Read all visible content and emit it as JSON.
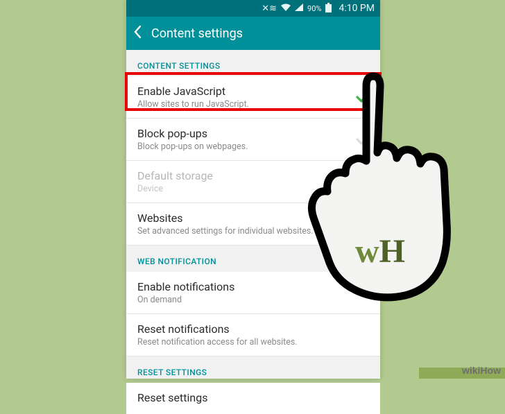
{
  "status": {
    "vibrate_icon": "📳",
    "wifi_icon": "📶",
    "signal_icon": "▲",
    "battery_percent": "90%",
    "battery_icon": "▮",
    "time": "4:10 PM"
  },
  "header": {
    "back_icon": "‹",
    "title": "Content settings"
  },
  "sections": {
    "content": {
      "label": "CONTENT SETTINGS",
      "items": [
        {
          "title": "Enable JavaScript",
          "sub": "Allow sites to run JavaScript.",
          "checked": true
        },
        {
          "title": "Block pop-ups",
          "sub": "Block pop-ups on webpages.",
          "checked_faint": true
        },
        {
          "title": "Default storage",
          "sub": "Device",
          "disabled": true
        },
        {
          "title": "Websites",
          "sub": "Set advanced settings for individual websites."
        }
      ]
    },
    "web_notification": {
      "label": "WEB NOTIFICATION",
      "items": [
        {
          "title": "Enable notifications",
          "sub": "On demand"
        },
        {
          "title": "Reset notifications",
          "sub": "Reset notification access for all websites."
        }
      ]
    },
    "reset": {
      "label": "RESET SETTINGS",
      "items": [
        {
          "title": "Reset settings",
          "sub": ""
        }
      ]
    }
  },
  "watermark": "wikiHow",
  "hand_label": "wH"
}
